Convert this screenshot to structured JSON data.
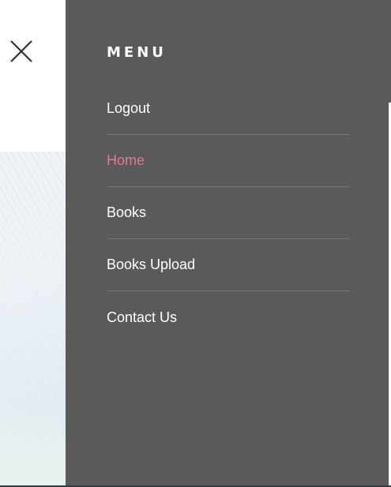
{
  "drawer": {
    "title": "MENU",
    "items": [
      {
        "label": "Logout",
        "active": false
      },
      {
        "label": "Home",
        "active": true
      },
      {
        "label": "Books",
        "active": false
      },
      {
        "label": "Books Upload",
        "active": false
      },
      {
        "label": "Contact Us",
        "active": false
      }
    ]
  },
  "icons": {
    "close": "close-icon"
  },
  "colors": {
    "drawer_background": "#5a5a5a",
    "menu_text": "#ffffff",
    "active_item": "#e07a8c",
    "divider": "#777777"
  }
}
